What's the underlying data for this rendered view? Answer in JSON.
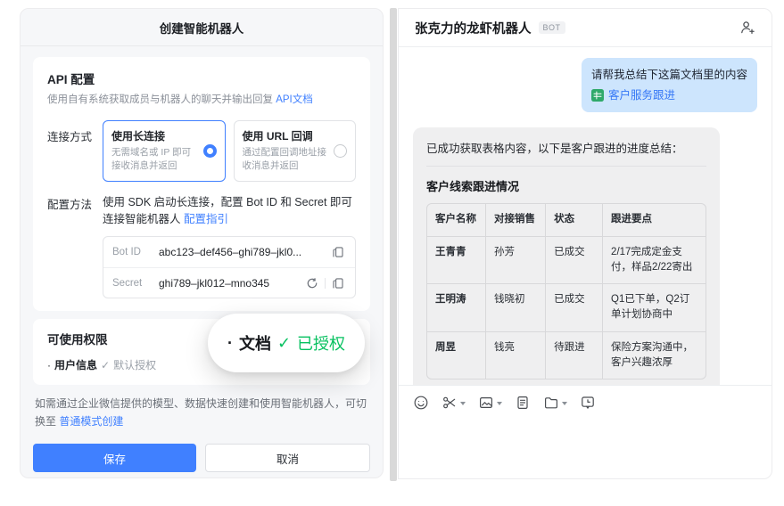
{
  "colors": {
    "accent": "#4080ff",
    "green": "#07c160",
    "user_bubble": "#cde5fd",
    "bot_bubble": "#efeff0",
    "sheet_green": "#2fa96a"
  },
  "glyphs": {
    "check": "✓",
    "bullet": "·"
  },
  "left_panel": {
    "title": "创建智能机器人",
    "api_section": {
      "title": "API 配置",
      "desc": "使用自有系统获取成员与机器人的聊天并输出回复",
      "doc_link": "API文档",
      "connection_label": "连接方式",
      "options": [
        {
          "title": "使用长连接",
          "desc": "无需域名或 IP 即可接收消息并返回",
          "selected": true
        },
        {
          "title": "使用 URL 回调",
          "desc": "通过配置回调地址接收消息并返回",
          "selected": false
        }
      ],
      "config_label": "配置方法",
      "config_desc": "使用 SDK 启动长连接，配置 Bot ID 和 Secret 即可连接智能机器人",
      "config_link": "配置指引",
      "credentials": [
        {
          "label": "Bot ID",
          "value": "abc123–def456–ghi789–jkl0..."
        },
        {
          "label": "Secret",
          "value": "ghi789–jkl012–mno345"
        }
      ]
    },
    "permissions": {
      "title": "可使用权限",
      "item_user": {
        "name": "用户信息",
        "status": "默认授权"
      },
      "zoom_item": {
        "name": "文档",
        "status": "已授权"
      }
    },
    "footer_note": "如需通过企业微信提供的模型、数据快速创建和使用智能机器人，可切换至",
    "footer_link": "普通模式创建",
    "save_label": "保存",
    "cancel_label": "取消"
  },
  "right_panel": {
    "bot_name": "张克力的龙虾机器人",
    "bot_badge": "BOT",
    "user_message": {
      "text": "请帮我总结下这篇文档里的内容",
      "attachment": "客户服务跟进"
    },
    "bot_message": {
      "intro": "已成功获取表格内容，以下是客户跟进的进度总结：",
      "table_title": "客户线索跟进情况",
      "table": {
        "headers": [
          "客户名称",
          "对接销售",
          "状态",
          "跟进要点"
        ],
        "rows": [
          [
            "王青青",
            "孙芳",
            "已成交",
            "2/17完成定金支付，样品2/22寄出"
          ],
          [
            "王明涛",
            "钱晓初",
            "已成交",
            "Q1已下单，Q2订单计划协商中"
          ],
          [
            "周昱",
            "钱亮",
            "待跟进",
            "保险方案沟通中，客户兴趣浓厚"
          ]
        ]
      }
    }
  }
}
